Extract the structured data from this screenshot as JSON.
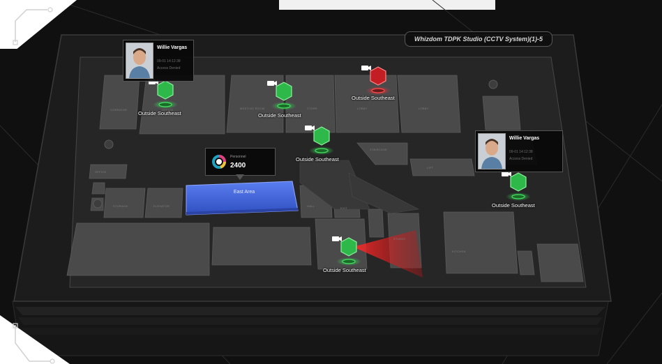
{
  "system_title": "Whizdom TDPK Studio (CCTV System)(1)-5",
  "colors": {
    "camera_normal": "#2fb84a",
    "camera_alarm": "#c21e24",
    "zone_fill": "#3d63d8",
    "accent": "#1fa3c2"
  },
  "stat": {
    "label": "Personnel",
    "value": "2400",
    "icon": "ring-chart-icon"
  },
  "zone": {
    "label": "East Area"
  },
  "cameras": [
    {
      "label": "Outside Southeast",
      "status": "normal"
    },
    {
      "label": "Outside Southeast",
      "status": "normal"
    },
    {
      "label": "Outside Southeast",
      "status": "alarm"
    },
    {
      "label": "Outside Southeast",
      "status": "normal"
    },
    {
      "label": "Outside Southeast",
      "status": "normal"
    },
    {
      "label": "Outside Southeast",
      "status": "normal"
    }
  ],
  "people": [
    {
      "name": "Willie Vargas",
      "line1": "09-01 14:12:38",
      "line2": "Access Denied"
    },
    {
      "name": "Willie Vargas",
      "line1": "09-01 14:12:38",
      "line2": "Access Denied"
    }
  ],
  "rooms": [
    "CORRIDOR",
    "OFFICE",
    "MEETING ROOM",
    "STORE",
    "LOBBY",
    "LOBBY",
    "STAIRCASE",
    "LIFT",
    "OFFICE",
    "STORAGE",
    "ELEVATOR",
    "HALL",
    "KITCHEN",
    "STUDIO",
    "TOILET",
    "EXIT"
  ]
}
